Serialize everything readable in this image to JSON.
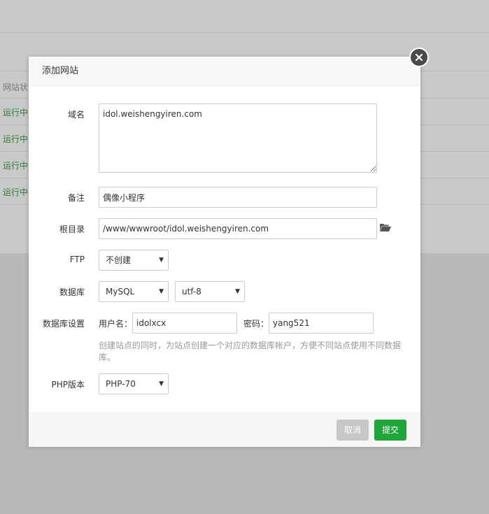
{
  "background": {
    "header_text": "网站状",
    "status_rows": [
      "运行中",
      "运行中",
      "运行中",
      "运行中"
    ]
  },
  "dialog": {
    "title": "添加网站",
    "domain": {
      "label": "域名",
      "value": "idol.weishengyiren.com"
    },
    "note": {
      "label": "备注",
      "value": "偶像小程序"
    },
    "root": {
      "label": "根目录",
      "value": "/www/wwwroot/idol.weishengyiren.com"
    },
    "ftp": {
      "label": "FTP",
      "selected": "不创建"
    },
    "database": {
      "label": "数据库",
      "type": "MySQL",
      "charset": "utf-8"
    },
    "db_settings": {
      "label": "数据库设置",
      "username_label": "用户名：",
      "username": "idolxcx",
      "password_label": "密码：",
      "password": "yang521",
      "hint": "创建站点的同时，为站点创建一个对应的数据库帐户，方便不同站点使用不同数据库。"
    },
    "php": {
      "label": "PHP版本",
      "selected": "PHP-70"
    },
    "buttons": {
      "cancel": "取消",
      "submit": "提交"
    }
  },
  "colors": {
    "submit": "#20a53a",
    "cancel": "#c7c7c7",
    "status_green": "#2f7a33"
  }
}
